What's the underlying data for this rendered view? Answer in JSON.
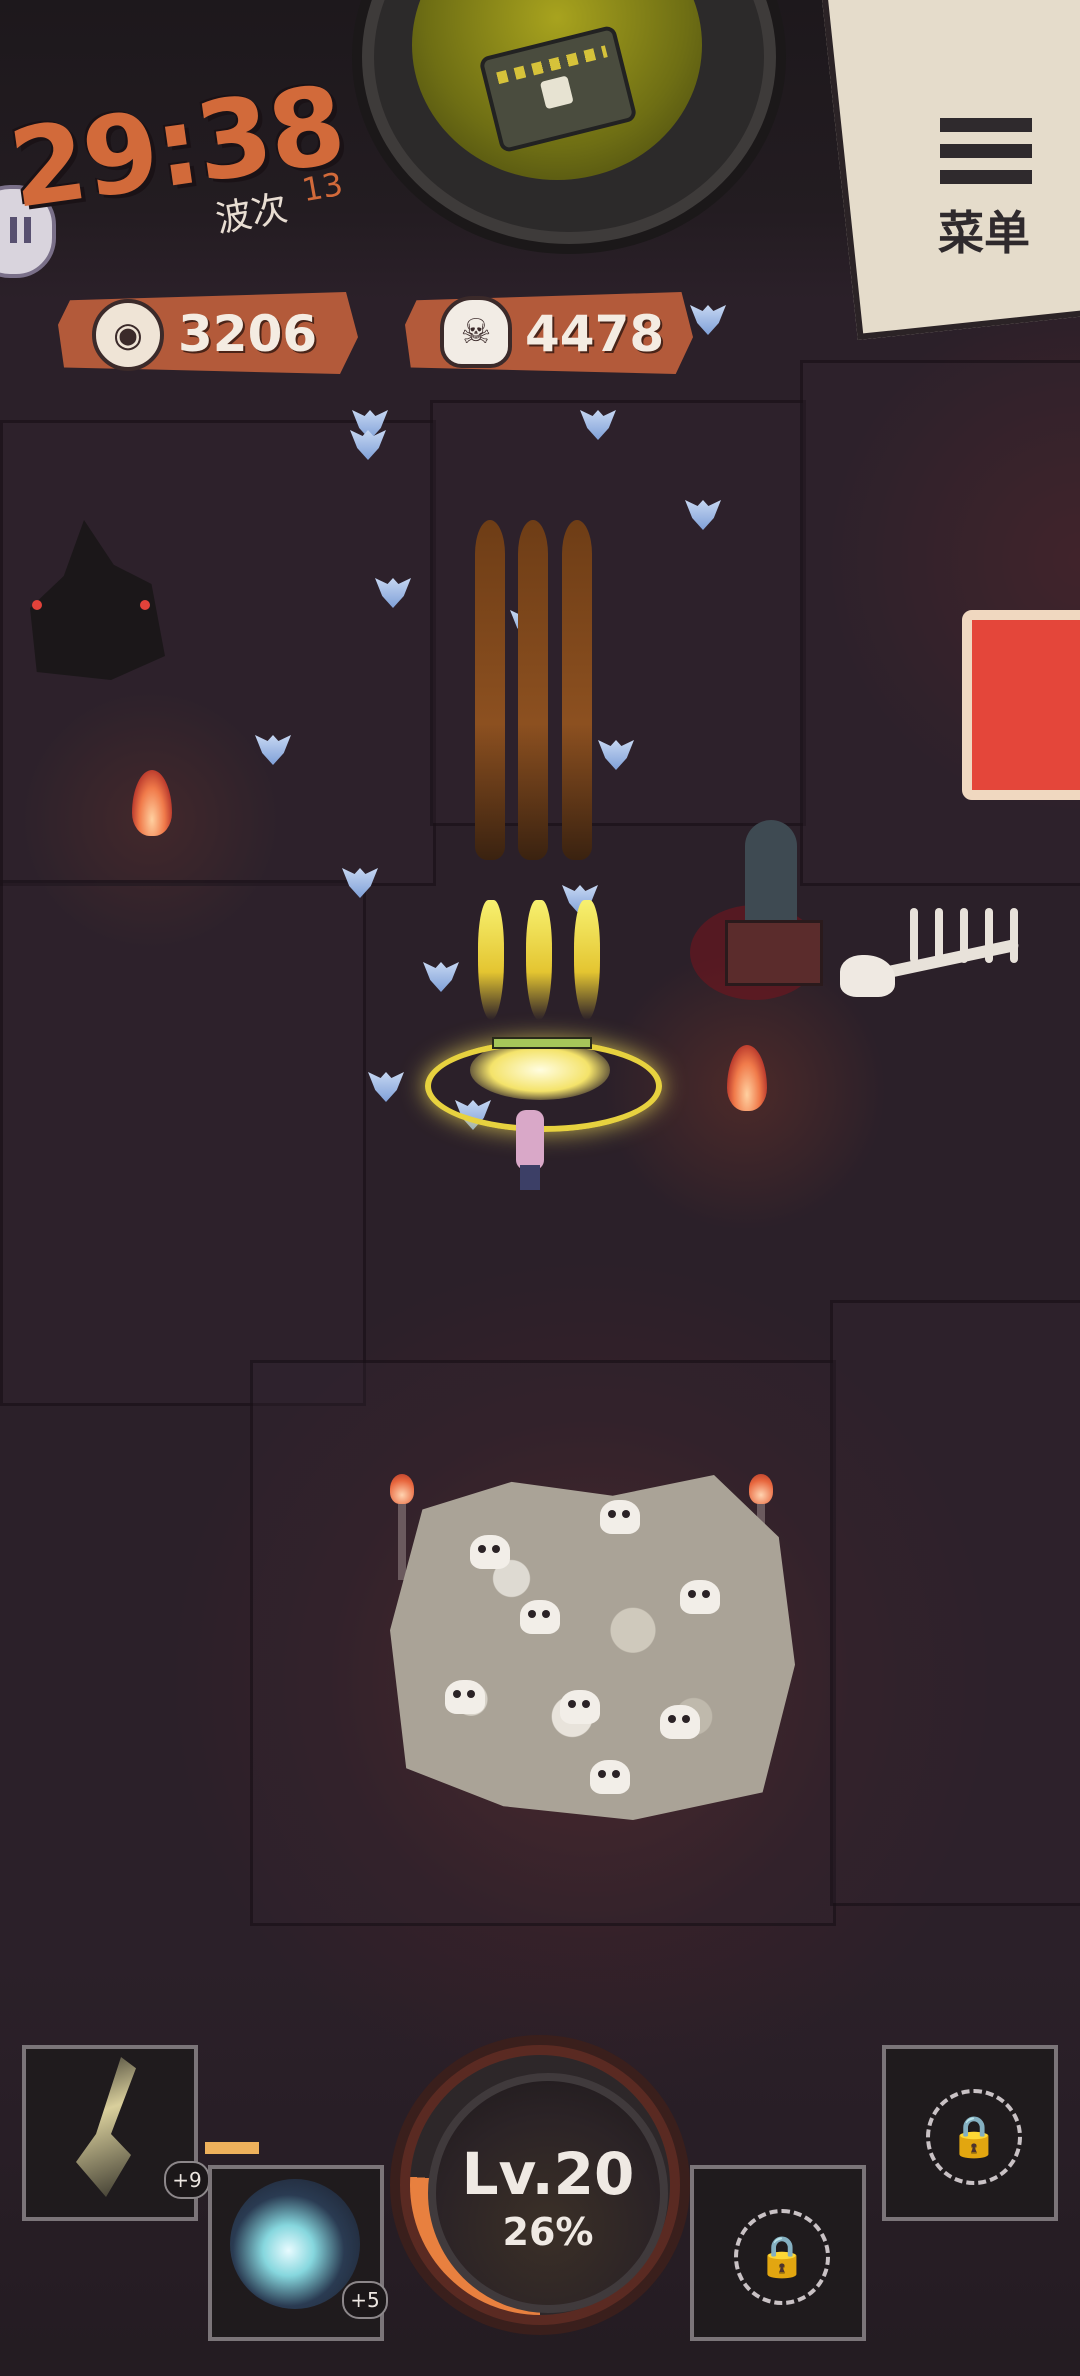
{
  "hud": {
    "timer": "29:38",
    "wave_label": "波次",
    "wave_value": "13",
    "menu_label": "菜单"
  },
  "currency": {
    "coins": "3206",
    "skulls": "4478"
  },
  "level": {
    "label": "Lv.20",
    "progress_text": "26%",
    "progress": 0.26
  },
  "weapons": [
    {
      "name": "sword-relic",
      "badge": "+9"
    },
    {
      "name": "crystal-relic",
      "badge": "+5"
    }
  ],
  "locked_slots": 2,
  "icons": {
    "menu": "hamburger-icon",
    "coin": "eye-coin-icon",
    "skull": "skull-icon",
    "lock": "lock-icon",
    "chest": "chest-icon"
  },
  "colors": {
    "accent_orange": "#d26a3a",
    "plate_red": "#b35a3a",
    "floor": "#2b2029",
    "xp": "#e8803f"
  }
}
